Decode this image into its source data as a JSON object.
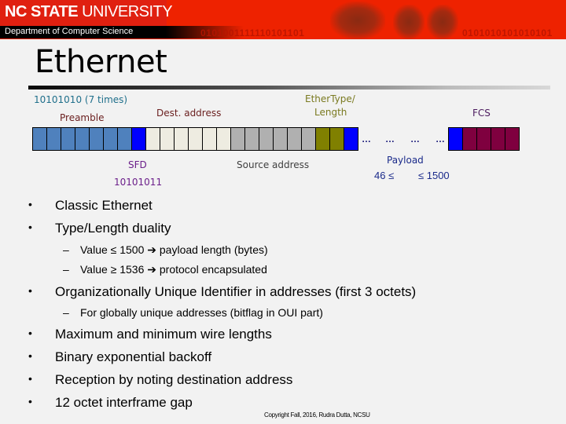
{
  "header": {
    "university_bold": "NC STATE",
    "university_light": " UNIVERSITY",
    "department": "Department of Computer Science",
    "binary_left": "0101001111110101101",
    "binary_right": "0101010101010101"
  },
  "slide": {
    "title": "Ethernet"
  },
  "diagram": {
    "labels": {
      "preamble_pattern": "10101010 (7 times)",
      "preamble": "Preamble",
      "dest_address": "Dest. address",
      "ethertype_line1": "EtherType/",
      "ethertype_line2": "Length",
      "fcs": "FCS",
      "sfd": "SFD",
      "sfd_pattern": "10101011",
      "source_address": "Source address",
      "payload": "Payload",
      "payload_min": "46 ≤",
      "payload_max": "≤  1500",
      "ellipsis": "…"
    },
    "fields": [
      {
        "name": "preamble",
        "octets": 7,
        "color": "#4f81bd"
      },
      {
        "name": "sfd",
        "octets": 1,
        "color": "#0000ff"
      },
      {
        "name": "dest-address",
        "octets": 6,
        "color": "#eeece1"
      },
      {
        "name": "source-address",
        "octets": 6,
        "color": "#b0b0b0"
      },
      {
        "name": "ethertype",
        "octets": 2,
        "color": "#808000"
      },
      {
        "name": "payload-start",
        "octets": 1,
        "color": "#0000ff"
      }
    ],
    "fields_tail": [
      {
        "name": "payload-end",
        "octets": 1,
        "color": "#0000ff"
      },
      {
        "name": "fcs",
        "octets": 4,
        "color": "#7f003f"
      }
    ],
    "colors": {
      "preamble_pattern_text": "#1f6f8b",
      "preamble_text": "#6b2020",
      "dest_text": "#6b2020",
      "ethertype_text": "#7a7a20",
      "fcs_text": "#4b1a5e",
      "sfd_text": "#6b1f8a",
      "source_text": "#404040",
      "payload_text": "#1a2a8a"
    }
  },
  "bullets": [
    {
      "text": "Classic Ethernet"
    },
    {
      "text": "Type/Length duality",
      "subs": [
        {
          "text": "Value ≤ 1500 ➔ payload length (bytes)"
        },
        {
          "text": "Value ≥ 1536 ➔ protocol encapsulated"
        }
      ]
    },
    {
      "text": "Organizationally Unique Identifier in addresses (first 3 octets)",
      "subs": [
        {
          "text": "For globally unique addresses (bitflag in OUI part)"
        }
      ]
    },
    {
      "text": "Maximum and minimum wire lengths"
    },
    {
      "text": "Binary exponential backoff"
    },
    {
      "text": "Reception by noting destination address"
    },
    {
      "text": "12 octet interframe gap"
    }
  ],
  "bullet_glyph": "•",
  "dash_glyph": "–",
  "footer": {
    "copyright": "Copyright Fall, 2016, Rudra Dutta, NCSU"
  }
}
